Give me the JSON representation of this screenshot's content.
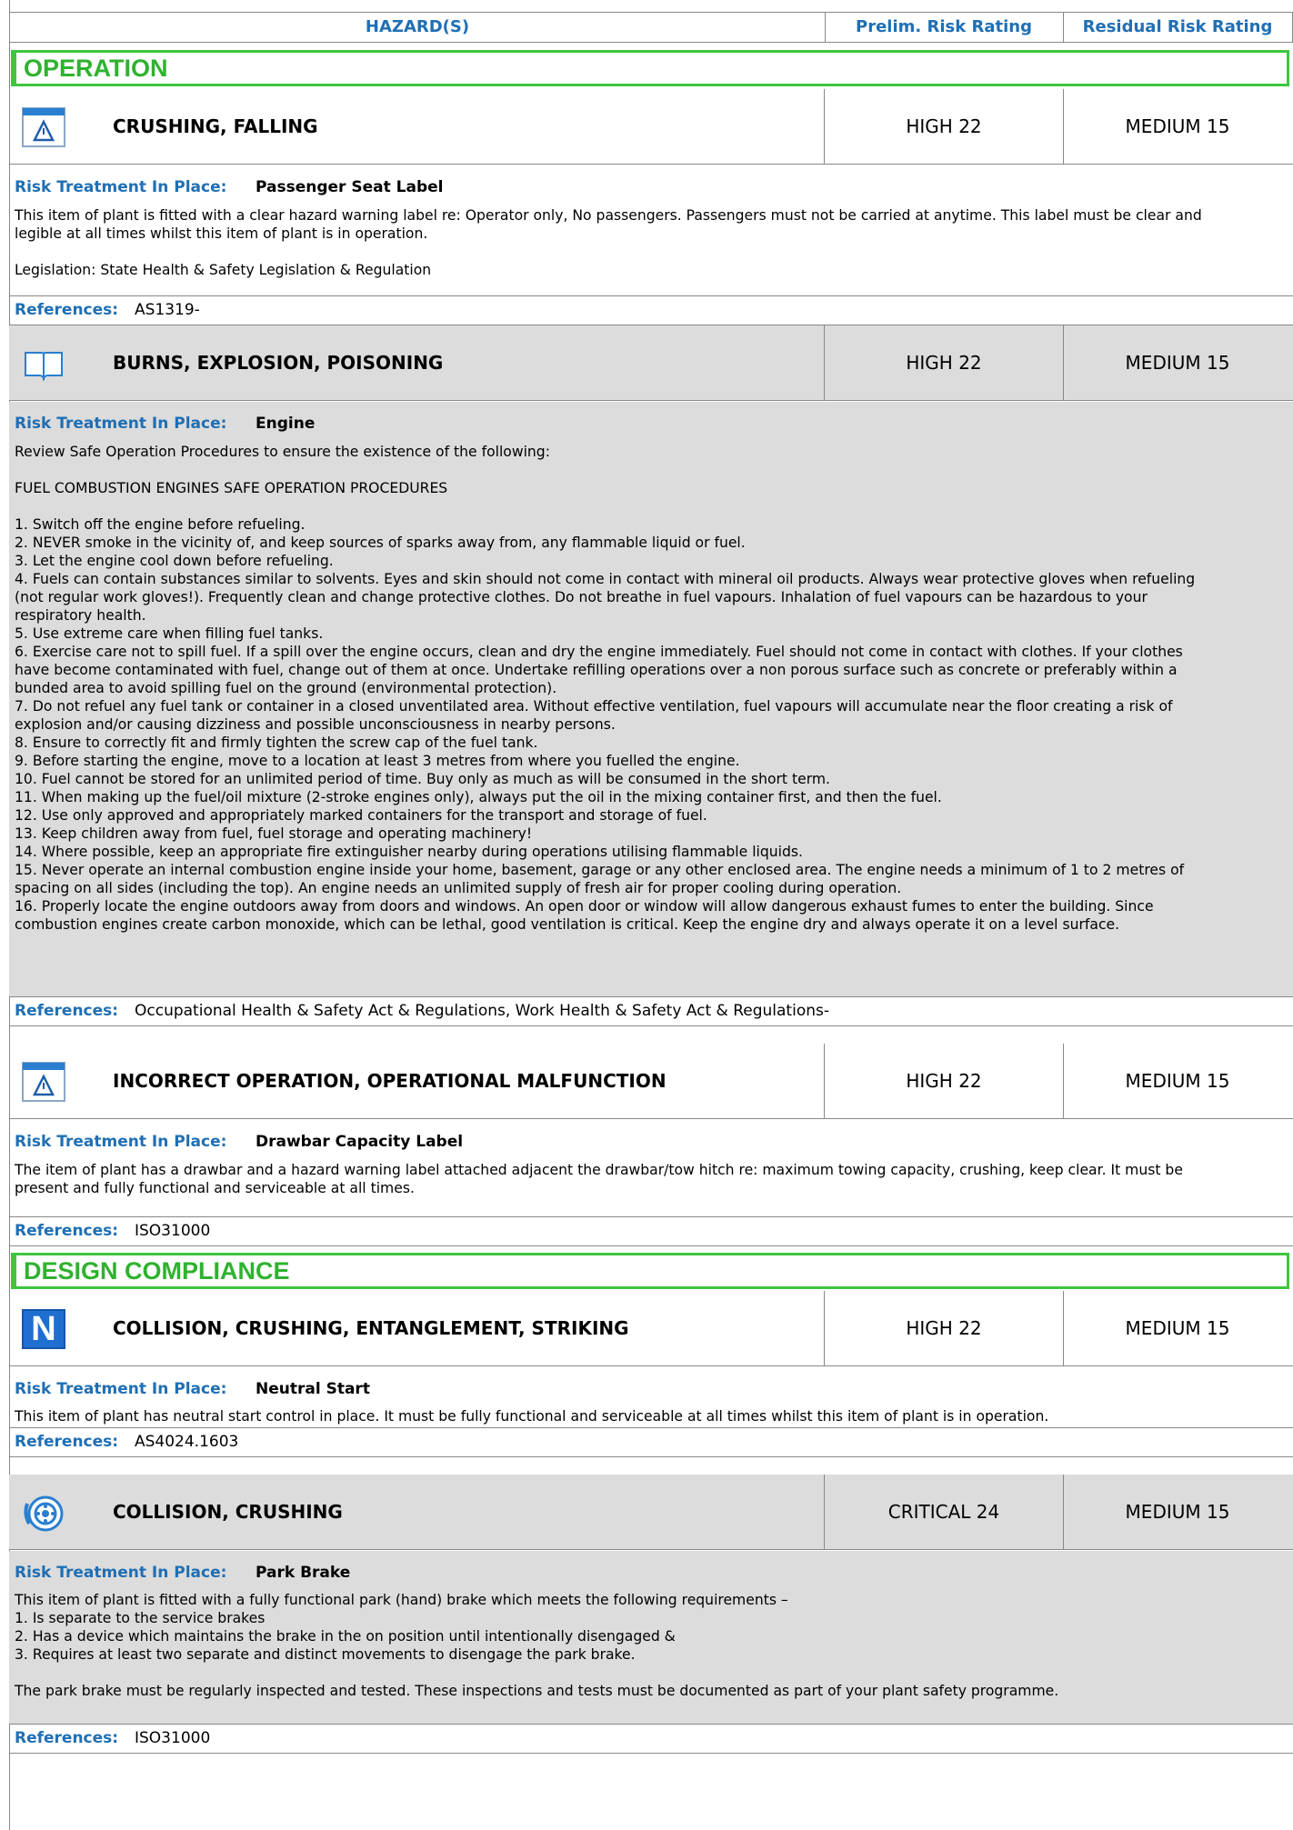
{
  "header": {
    "col_hazards": "HAZARD(S)",
    "col_prelim": "Prelim. Risk Rating",
    "col_residual": "Residual Risk Rating"
  },
  "sections": {
    "operation": "OPERATION",
    "design": "DESIGN COMPLIANCE"
  },
  "labels": {
    "treatment": "Risk Treatment In Place:",
    "references": "References:"
  },
  "items": [
    {
      "icon": "warning-label-icon",
      "title": "CRUSHING, FALLING",
      "prelim": "HIGH 22",
      "residual": "MEDIUM 15",
      "treatment": "Passenger Seat Label",
      "text": "This item of plant is fitted with a clear hazard warning label re: Operator only, No passengers. Passengers must not be carried at anytime. This label must be clear and\nlegible at all times whilst this item of plant is in operation.\n\nLegislation: State Health & Safety Legislation & Regulation",
      "references": "AS1319-"
    },
    {
      "icon": "book-icon",
      "title": "BURNS, EXPLOSION, POISONING",
      "prelim": "HIGH 22",
      "residual": "MEDIUM 15",
      "treatment": "Engine",
      "text": "Review Safe Operation Procedures to ensure the existence of the following:\n\nFUEL COMBUSTION ENGINES SAFE OPERATION PROCEDURES\n\n1. Switch off the engine before refueling.\n2. NEVER smoke in the vicinity of, and keep sources of sparks away from, any flammable liquid or fuel.\n3. Let the engine cool down before refueling.\n4. Fuels can contain substances similar to solvents. Eyes and skin should not come in contact with mineral oil products. Always wear protective gloves when refueling\n(not regular work gloves!). Frequently clean and change protective clothes. Do not breathe in fuel vapours. Inhalation of fuel vapours can be hazardous to your\nrespiratory health.\n5. Use extreme care when filling fuel tanks.\n6. Exercise care not to spill fuel. If a spill over the engine occurs, clean and dry the engine immediately. Fuel should not come in contact with clothes. If your clothes\nhave become contaminated with fuel, change out of them at once. Undertake refilling operations over a non porous surface such as concrete or preferably within a\nbunded area to avoid spilling fuel on the ground (environmental protection).\n7. Do not refuel any fuel tank or container in a closed unventilated area. Without effective ventilation, fuel vapours will accumulate near the floor creating a risk of\nexplosion and/or causing dizziness and possible unconsciousness in nearby persons.\n8. Ensure to correctly fit and firmly tighten the screw cap of the fuel tank.\n9. Before starting the engine, move to a location at least 3 metres from where you fuelled the engine.\n10. Fuel cannot be stored for an unlimited period of time. Buy only as much as will be consumed in the short term.\n11. When making up the fuel/oil mixture (2-stroke engines only), always put the oil in the mixing container first, and then the fuel.\n12. Use only approved and appropriately marked containers for the transport and storage of fuel.\n13. Keep children away from fuel, fuel storage and operating machinery!\n14. Where possible, keep an appropriate fire extinguisher nearby during operations utilising flammable liquids.\n15. Never operate an internal combustion engine inside your home, basement, garage or any other enclosed area. The engine needs a minimum of 1 to 2 metres of\nspacing on all sides (including the top). An engine needs an unlimited supply of fresh air for proper cooling during operation.\n16. Properly locate the engine outdoors away from doors and windows. An open door or window will allow dangerous exhaust fumes to enter the building. Since\ncombustion engines create carbon monoxide, which can be lethal, good ventilation is critical. Keep the engine dry and always operate it on a level surface.",
      "references": "Occupational Health & Safety Act & Regulations, Work Health & Safety Act & Regulations-"
    },
    {
      "icon": "warning-label-icon",
      "title": "INCORRECT OPERATION, OPERATIONAL MALFUNCTION",
      "prelim": "HIGH 22",
      "residual": "MEDIUM 15",
      "treatment": "Drawbar Capacity Label",
      "text": "The item of plant has a drawbar and a hazard warning label attached adjacent the drawbar/tow hitch re: maximum towing capacity, crushing, keep clear. It must be\npresent and fully functional and serviceable at all times.",
      "references": "ISO31000"
    },
    {
      "icon": "neutral-start-icon",
      "icon_letter": "N",
      "title": "COLLISION, CRUSHING, ENTANGLEMENT, STRIKING",
      "prelim": "HIGH 22",
      "residual": "MEDIUM 15",
      "treatment": "Neutral Start",
      "text": "This item of plant has neutral start control in place. It must be fully functional and serviceable at all times whilst this item of plant is in operation.",
      "references": "AS4024.1603"
    },
    {
      "icon": "brake-disc-icon",
      "title": "COLLISION, CRUSHING",
      "prelim": "CRITICAL 24",
      "residual": "MEDIUM 15",
      "treatment": "Park Brake",
      "text": "This item of plant is fitted with a fully functional park (hand) brake which meets the following requirements –\n1. Is separate to the service brakes\n2. Has a device which maintains the brake in the on position until intentionally disengaged &\n3. Requires at least two separate and distinct movements to disengage the park brake.\n\nThe park brake must be regularly inspected and tested. These inspections and tests must be documented as part of your plant safety programme.",
      "references": "ISO31000"
    }
  ]
}
